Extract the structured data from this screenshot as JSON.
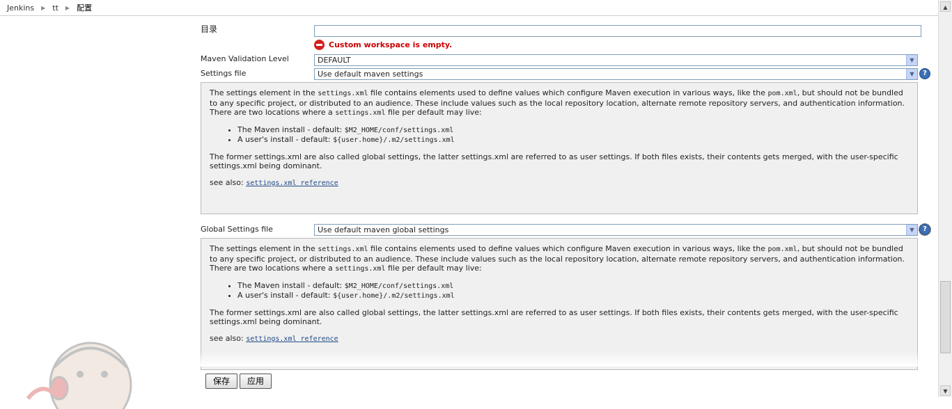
{
  "breadcrumb": [
    "Jenkins",
    "tt",
    "配置"
  ],
  "workspace": {
    "label": "目录",
    "value": "",
    "error": "Custom workspace is empty."
  },
  "maven_validation": {
    "label": "Maven Validation Level",
    "selected": "DEFAULT"
  },
  "settings_file": {
    "label": "Settings file",
    "selected": "Use default maven settings"
  },
  "global_settings_file": {
    "label": "Global Settings file",
    "selected": "Use default maven global settings"
  },
  "help": {
    "p1_a": "The settings element in the ",
    "p1_code1": "settings.xml",
    "p1_b": " file contains elements used to define values which configure Maven execution in various ways, like the ",
    "p1_code2": "pom.xml",
    "p1_c": ", but should not be bundled to any specific project, or distributed to an audience. These include values such as the local repository location, alternate remote repository servers, and authentication information.",
    "p2_a": "There are two locations where a ",
    "p2_code": "settings.xml",
    "p2_b": " file per default may live:",
    "li1_a": "The Maven install - default: ",
    "li1_code": "$M2_HOME/conf/settings.xml",
    "li2_a": "A user's install - default: ",
    "li2_code": "${user.home}/.m2/settings.xml",
    "p3": "The former settings.xml are also called global settings, the latter settings.xml are referred to as user settings. If both files exists, their contents gets merged, with the user-specific settings.xml being dominant.",
    "see_also": "see also: ",
    "link": "settings.xml reference"
  },
  "buttons": {
    "save": "保存",
    "apply": "应用"
  },
  "icons": {
    "help": "help-icon",
    "error": "error-icon",
    "mascot": "jenkins-butler-icon"
  },
  "colors": {
    "error": "#cc0000",
    "help_bg": "#f0f0f0",
    "link": "#204a87",
    "help_icon": "#3c6eb4"
  }
}
